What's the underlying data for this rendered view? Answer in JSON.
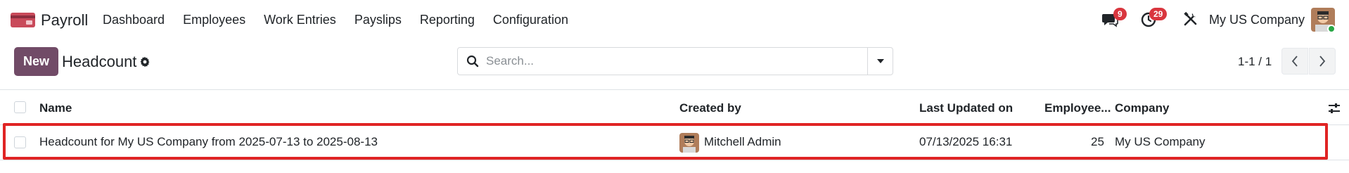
{
  "app": {
    "name": "Payroll"
  },
  "menu": [
    "Dashboard",
    "Employees",
    "Work Entries",
    "Payslips",
    "Reporting",
    "Configuration"
  ],
  "systray": {
    "messages_count": "9",
    "activities_count": "29",
    "company": "My US Company"
  },
  "control": {
    "new_label": "New",
    "title": "Headcount",
    "search_placeholder": "Search...",
    "pager": "1-1 / 1"
  },
  "table": {
    "columns": {
      "name": "Name",
      "created_by": "Created by",
      "last_updated": "Last Updated on",
      "employees": "Employee...",
      "company": "Company"
    },
    "rows": [
      {
        "name": "Headcount for My US Company from 2025-07-13 to 2025-08-13",
        "created_by": "Mitchell Admin",
        "last_updated": "07/13/2025 16:31",
        "employees": "25",
        "company": "My US Company"
      }
    ]
  },
  "colors": {
    "brand": "#714b67",
    "badge": "#d9363e",
    "highlight": "#e02424"
  }
}
